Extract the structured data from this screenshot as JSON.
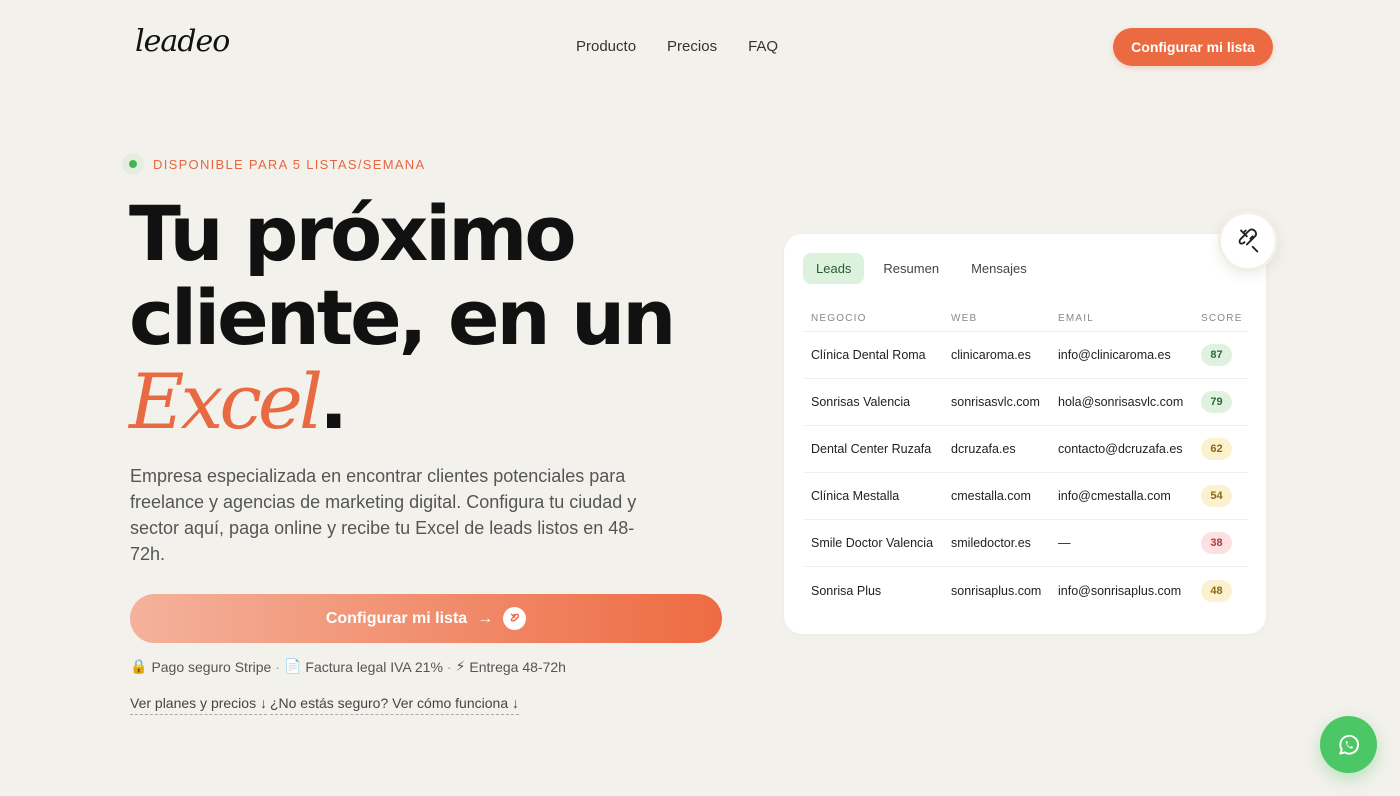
{
  "brand": {
    "logo": "leadeo",
    "accent_color": "#ec6a41"
  },
  "nav": {
    "items": [
      "Producto",
      "Precios",
      "FAQ"
    ],
    "cta_label": "Configurar mi lista"
  },
  "hero": {
    "badge": "DISPONIBLE PARA 5 LISTAS/SEMANA",
    "headline_line1": "Tu próximo",
    "headline_line2": "cliente, en un",
    "headline_accent": "Excel",
    "headline_period": ".",
    "description": "Empresa especializada en encontrar clientes potenciales para freelance y agencias de marketing digital. Configura tu ciudad y sector aquí, paga online y recibe tu Excel de leads listos en 48-72h.",
    "cta_label": "Configurar mi lista",
    "cta_arrow": "→",
    "trust": [
      {
        "icon": "lock-icon",
        "glyph": "🔒",
        "text": "Pago seguro Stripe"
      },
      {
        "icon": "document-icon",
        "glyph": "📄",
        "text": "Factura legal IVA 21%"
      },
      {
        "icon": "lightning-icon",
        "glyph": "⚡",
        "text": "Entrega 48-72h"
      }
    ],
    "trust_separator": "·",
    "links": [
      "Ver planes y precios ↓",
      "¿No estás seguro? Ver cómo funciona ↓"
    ]
  },
  "card": {
    "tabs": [
      "Leads",
      "Resumen",
      "Mensajes"
    ],
    "active_tab": "Leads",
    "columns": [
      "NEGOCIO",
      "WEB",
      "EMAIL",
      "SCORE"
    ],
    "rows": [
      {
        "negocio": "Clínica Dental Roma",
        "web": "clinicaroma.es",
        "email": "info@clinicaroma.es",
        "score": "87",
        "level": "high"
      },
      {
        "negocio": "Sonrisas Valencia",
        "web": "sonrisasvlc.com",
        "email": "hola@sonrisasvlc.com",
        "score": "79",
        "level": "high"
      },
      {
        "negocio": "Dental Center Ruzafa",
        "web": "dcruzafa.es",
        "email": "contacto@dcruzafa.es",
        "score": "62",
        "level": "mid"
      },
      {
        "negocio": "Clínica Mestalla",
        "web": "cmestalla.com",
        "email": "info@cmestalla.com",
        "score": "54",
        "level": "mid"
      },
      {
        "negocio": "Smile Doctor Valencia",
        "web": "smiledoctor.es",
        "email": "—",
        "score": "38",
        "level": "low"
      },
      {
        "negocio": "Sonrisa Plus",
        "web": "sonrisaplus.com",
        "email": "info@sonrisaplus.com",
        "score": "48",
        "level": "mid"
      }
    ]
  },
  "floating": {
    "magnet_icon": "magnet-icon",
    "whatsapp_icon": "whatsapp-icon"
  }
}
